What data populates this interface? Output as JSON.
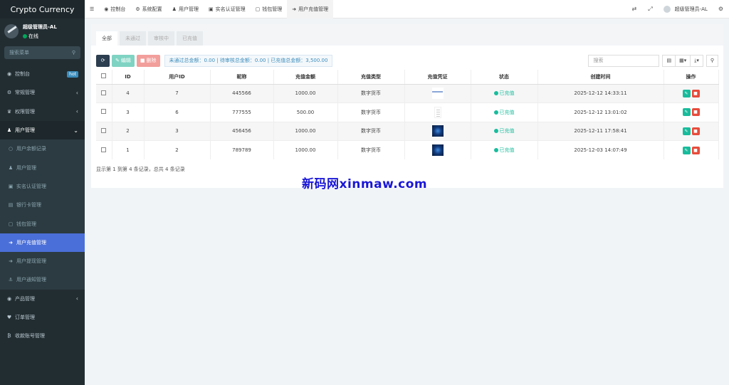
{
  "app": {
    "title": "Crypto Currency"
  },
  "user": {
    "name": "超级管理员-AL",
    "status": "在线"
  },
  "sidebar": {
    "search_placeholder": "搜索菜单",
    "items": [
      {
        "label": "控制台",
        "badge": "hot"
      },
      {
        "label": "常规管理"
      },
      {
        "label": "权限管理"
      },
      {
        "label": "用户管理"
      }
    ],
    "sub_items": [
      {
        "label": "用户余额记录"
      },
      {
        "label": "用户管理"
      },
      {
        "label": "实名认证管理"
      },
      {
        "label": "银行卡管理"
      },
      {
        "label": "钱包管理"
      },
      {
        "label": "用户充值管理"
      },
      {
        "label": "用户提现管理"
      },
      {
        "label": "用户通知管理"
      }
    ],
    "bottom_items": [
      {
        "label": "产品管理"
      },
      {
        "label": "订单管理"
      },
      {
        "label": "收款账号管理"
      }
    ]
  },
  "topnav": {
    "items": [
      {
        "label": "控制台"
      },
      {
        "label": "系统配置"
      },
      {
        "label": "用户管理"
      },
      {
        "label": "实名认证管理"
      },
      {
        "label": "钱包管理"
      },
      {
        "label": "用户充值管理"
      }
    ],
    "user": "超级管理员-AL"
  },
  "tabs": [
    "全部",
    "未通过",
    "审核中",
    "已充值"
  ],
  "toolbar": {
    "edit": "编辑",
    "delete": "删除",
    "summary": "未通过总金额：0.00 | 待审核总金额：0.00 | 已充值总金额：3,500.00",
    "search_placeholder": "搜索"
  },
  "table": {
    "headers": [
      "ID",
      "用户ID",
      "昵称",
      "充值金额",
      "充值类型",
      "充值凭证",
      "状态",
      "创建时间",
      "操作"
    ],
    "rows": [
      {
        "id": "4",
        "uid": "7",
        "nick": "445566",
        "amount": "1000.00",
        "type": "数字货币",
        "proof": "doc",
        "status": "已充值",
        "time": "2025-12-12 14:33:11"
      },
      {
        "id": "3",
        "uid": "6",
        "nick": "777555",
        "amount": "500.00",
        "type": "数字货币",
        "proof": "paper",
        "status": "已充值",
        "time": "2025-12-12 13:01:02"
      },
      {
        "id": "2",
        "uid": "3",
        "nick": "456456",
        "amount": "1000.00",
        "type": "数字货币",
        "proof": "blue",
        "status": "已充值",
        "time": "2025-12-11 17:58:41"
      },
      {
        "id": "1",
        "uid": "2",
        "nick": "789789",
        "amount": "1000.00",
        "type": "数字货币",
        "proof": "blue",
        "status": "已充值",
        "time": "2025-12-03 14:07:49"
      }
    ]
  },
  "pagination": {
    "info": "显示第 1 到第 4 条记录，总共 4 条记录"
  },
  "watermark": "新码网xinmaw.com",
  "colors": {
    "sidebar_bg": "#222d32",
    "active_menu": "#4b6fd8",
    "success": "#18bc9c",
    "danger": "#e74c3c"
  }
}
